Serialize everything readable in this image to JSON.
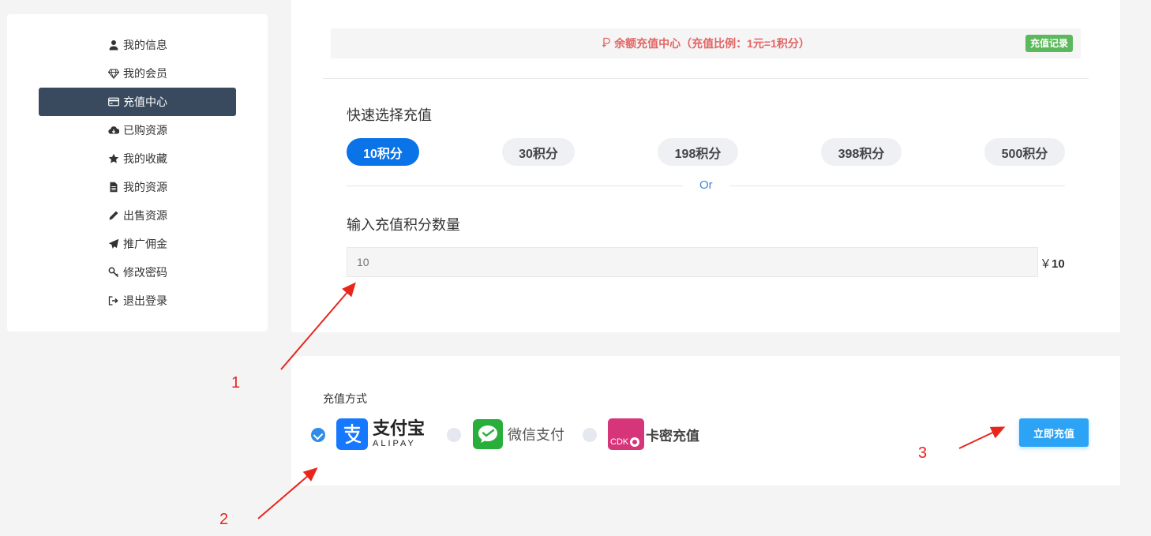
{
  "sidebar": {
    "items": [
      {
        "label": "我的信息",
        "icon": "user-icon",
        "active": false
      },
      {
        "label": "我的会员",
        "icon": "diamond-icon",
        "active": false
      },
      {
        "label": "充值中心",
        "icon": "credit-card-icon",
        "active": true
      },
      {
        "label": "已购资源",
        "icon": "cloud-download-icon",
        "active": false
      },
      {
        "label": "我的收藏",
        "icon": "star-icon",
        "active": false
      },
      {
        "label": "我的资源",
        "icon": "file-icon",
        "active": false
      },
      {
        "label": "出售资源",
        "icon": "pencil-icon",
        "active": false
      },
      {
        "label": "推广佣金",
        "icon": "paper-plane-icon",
        "active": false
      },
      {
        "label": "修改密码",
        "icon": "key-icon",
        "active": false
      },
      {
        "label": "退出登录",
        "icon": "sign-out-icon",
        "active": false
      }
    ]
  },
  "recharge": {
    "banner_text": "余额充值中心（充值比例：1元=1积分）",
    "record_label": "充值记录",
    "quick_title": "快速选择充值",
    "amounts": [
      "10积分",
      "30积分",
      "198积分",
      "398积分",
      "500积分"
    ],
    "selected_amount_index": 0,
    "or_text": "Or",
    "input_title": "输入充值积分数量",
    "input_placeholder": "10",
    "currency_symbol": "￥",
    "price": "10"
  },
  "payment": {
    "title": "充值方式",
    "alipay_cn": "支付宝",
    "alipay_en": "ALIPAY",
    "wechat_label": "微信支付",
    "cdk_logo_text": "CDK",
    "cdk_label": "卡密充值",
    "selected": "alipay",
    "submit_label": "立即充值"
  },
  "annotations": [
    "1",
    "2",
    "3"
  ],
  "colors": {
    "sidebar_active": "#3a4a5e",
    "amount_active": "#0b73e8",
    "banner_text": "#e36464",
    "record_badge": "#5cb85c",
    "submit": "#2da3f5",
    "annotation": "#e8261c"
  }
}
